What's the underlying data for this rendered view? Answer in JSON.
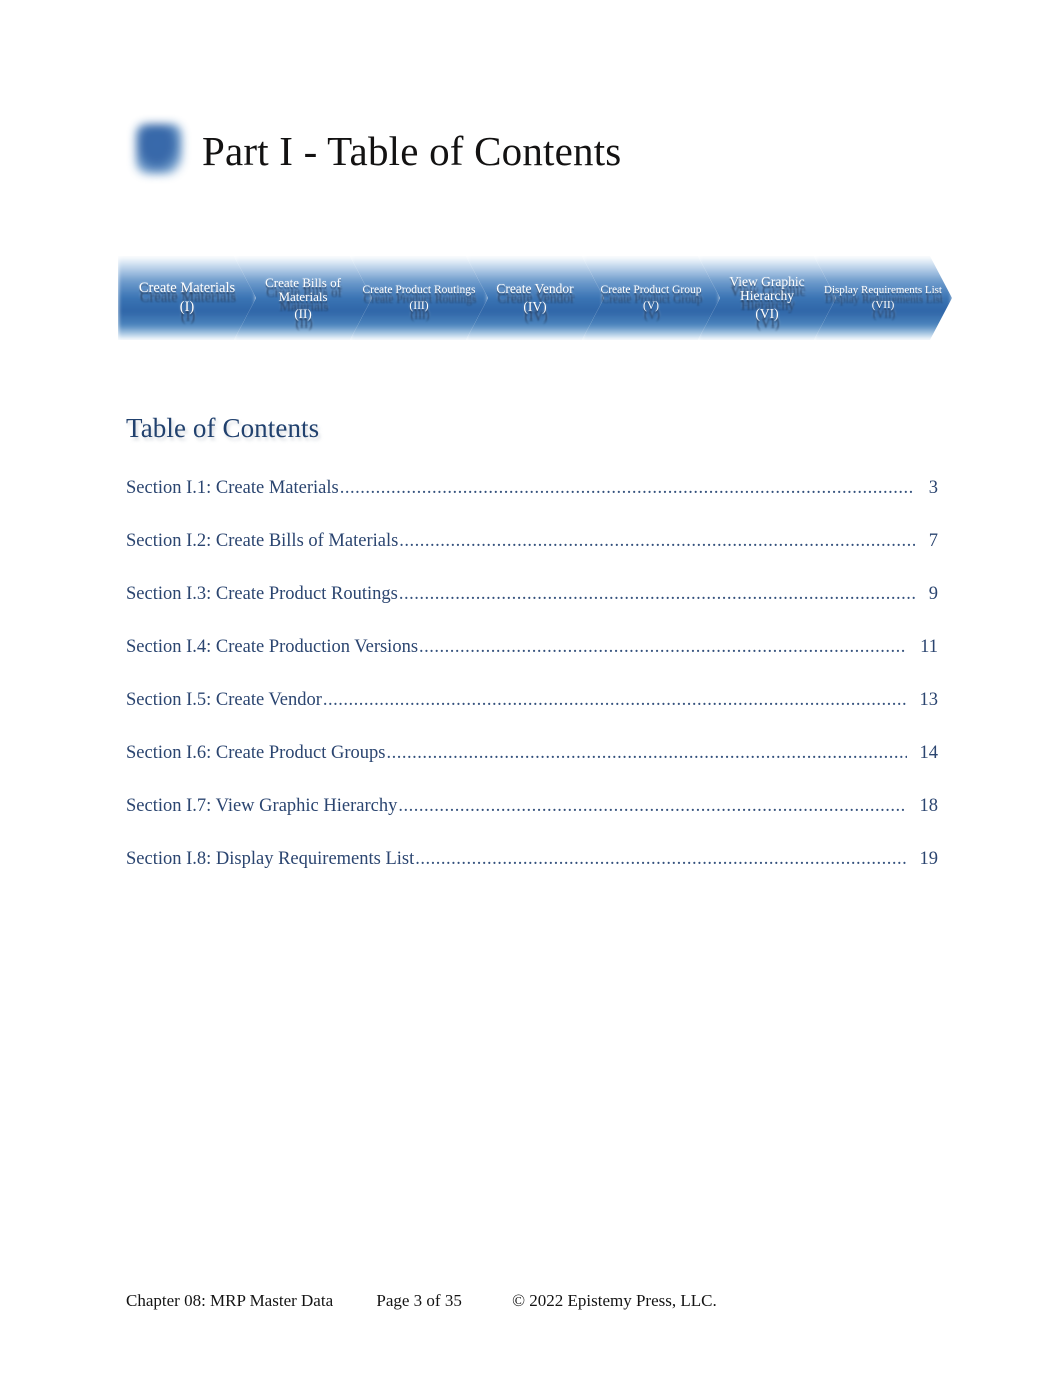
{
  "document": {
    "title": "Part I - Table of Contents",
    "bullet_icon": "blue-rounded-square-icon",
    "accent_color": "#2f66a8",
    "text_color": "#2b4570"
  },
  "process_flow": {
    "steps": [
      {
        "name": "Create Materials",
        "roman": "(I)"
      },
      {
        "name": "Create Bills of Materials",
        "roman": "(II)"
      },
      {
        "name": "Create Product Routings",
        "roman": "(III)"
      },
      {
        "name": "Create Vendor",
        "roman": "(IV)"
      },
      {
        "name": "Create Product Group",
        "roman": "(V)"
      },
      {
        "name": "View Graphic Hierarchy",
        "roman": "(VI)"
      },
      {
        "name": "Display Requirements List",
        "roman": "(VII)"
      }
    ]
  },
  "toc": {
    "heading": "Table of Contents",
    "leader": "....................................................................................................................................................................................................",
    "entries": [
      {
        "label": "Section I.1: Create Materials",
        "page": "3"
      },
      {
        "label": "Section I.2: Create Bills of Materials",
        "page": "7"
      },
      {
        "label": "Section I.3: Create Product Routings",
        "page": "9"
      },
      {
        "label": "Section I.4: Create Production Versions",
        "page": "11"
      },
      {
        "label": "Section I.5: Create Vendor",
        "page": "13"
      },
      {
        "label": "Section I.6: Create Product Groups",
        "page": "14"
      },
      {
        "label": "Section I.7: View Graphic Hierarchy",
        "page": "18"
      },
      {
        "label": "Section I.8: Display Requirements List",
        "page": "19"
      }
    ]
  },
  "footer": {
    "chapter": "Chapter 08: MRP Master Data",
    "page": "Page 3 of 35",
    "copyright": "© 2022 Epistemy Press, LLC."
  }
}
